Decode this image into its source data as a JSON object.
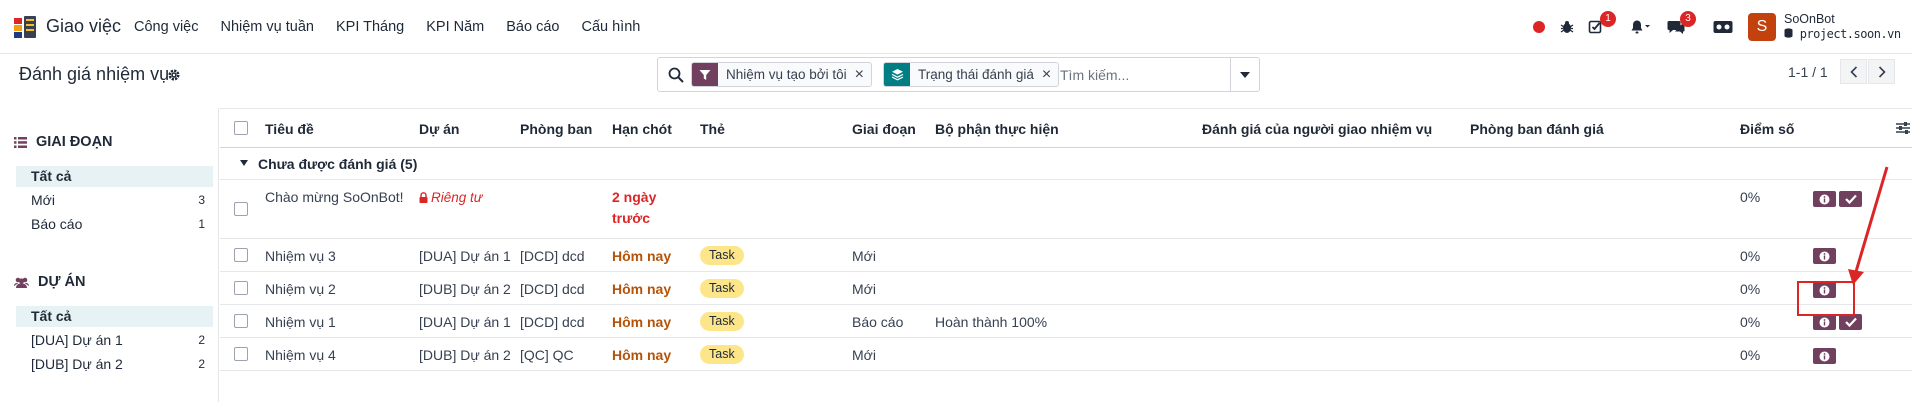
{
  "app": {
    "name": "Giao việc",
    "menu": [
      "Công việc",
      "Nhiệm vụ tuần",
      "KPI Tháng",
      "KPI Năm",
      "Báo cáo",
      "Cấu hình"
    ]
  },
  "systray": {
    "activity_count": "1",
    "messages_count": "3",
    "user_initial": "S",
    "user_name": "SoOnBot",
    "database": "project.soon.vn"
  },
  "control_panel": {
    "title": "Đánh giá nhiệm vụ",
    "facets": [
      {
        "label": "Nhiệm vụ tạo bởi tôi",
        "icon": "filter-icon",
        "color": "#71405e"
      },
      {
        "label": "Trạng thái đánh giá",
        "icon": "layers-icon",
        "color": "#017e84"
      }
    ],
    "search_placeholder": "Tìm kiếm...",
    "pager": "1-1 / 1"
  },
  "sidebar": {
    "stage_header": "GIAI ĐOẠN",
    "stage_items": [
      {
        "label": "Tất cả",
        "count": ""
      },
      {
        "label": "Mới",
        "count": "3"
      },
      {
        "label": "Báo cáo",
        "count": "1"
      }
    ],
    "project_header": "DỰ ÁN",
    "project_items": [
      {
        "label": "Tất cả",
        "count": ""
      },
      {
        "label": "[DUA] Dự án 1",
        "count": "2"
      },
      {
        "label": "[DUB] Dự án 2",
        "count": "2"
      }
    ]
  },
  "table": {
    "columns": [
      "Tiêu đề",
      "Dự án",
      "Phòng ban",
      "Hạn chót",
      "Thẻ",
      "Giai đoạn",
      "Bộ phận thực hiện",
      "Đánh giá của người giao nhiệm vụ",
      "Phòng ban đánh giá",
      "Điểm số"
    ],
    "group_label": "Chưa được đánh giá (5)",
    "rows": [
      {
        "title": "Chào mừng SoOnBot!",
        "project": "Riêng tư",
        "department": "",
        "deadline": "2 ngày trước",
        "tag": "",
        "stage": "",
        "unit": "",
        "score": "0%"
      },
      {
        "title": "Nhiệm vụ 3",
        "project": "[DUA] Dự án 1",
        "department": "[DCD] dcd",
        "deadline": "Hôm nay",
        "tag": "Task",
        "stage": "Mới",
        "unit": "",
        "score": "0%"
      },
      {
        "title": "Nhiệm vụ 2",
        "project": "[DUB] Dự án 2",
        "department": "[DCD] dcd",
        "deadline": "Hôm nay",
        "tag": "Task",
        "stage": "Mới",
        "unit": "",
        "score": "0%"
      },
      {
        "title": "Nhiệm vụ 1",
        "project": "[DUA] Dự án 1",
        "department": "[DCD] dcd",
        "deadline": "Hôm nay",
        "tag": "Task",
        "stage": "Báo cáo",
        "unit": "Hoàn thành 100%",
        "score": "0%"
      },
      {
        "title": "Nhiệm vụ 4",
        "project": "[DUB] Dự án 2",
        "department": "[QC] QC",
        "deadline": "Hôm nay",
        "tag": "Task",
        "stage": "Mới",
        "unit": "",
        "score": "0%"
      }
    ]
  },
  "colors": {
    "brand": "#71405e",
    "accent": "#017e84",
    "danger": "#dc2626",
    "warning": "#b45309",
    "tag": "#fde68a"
  }
}
